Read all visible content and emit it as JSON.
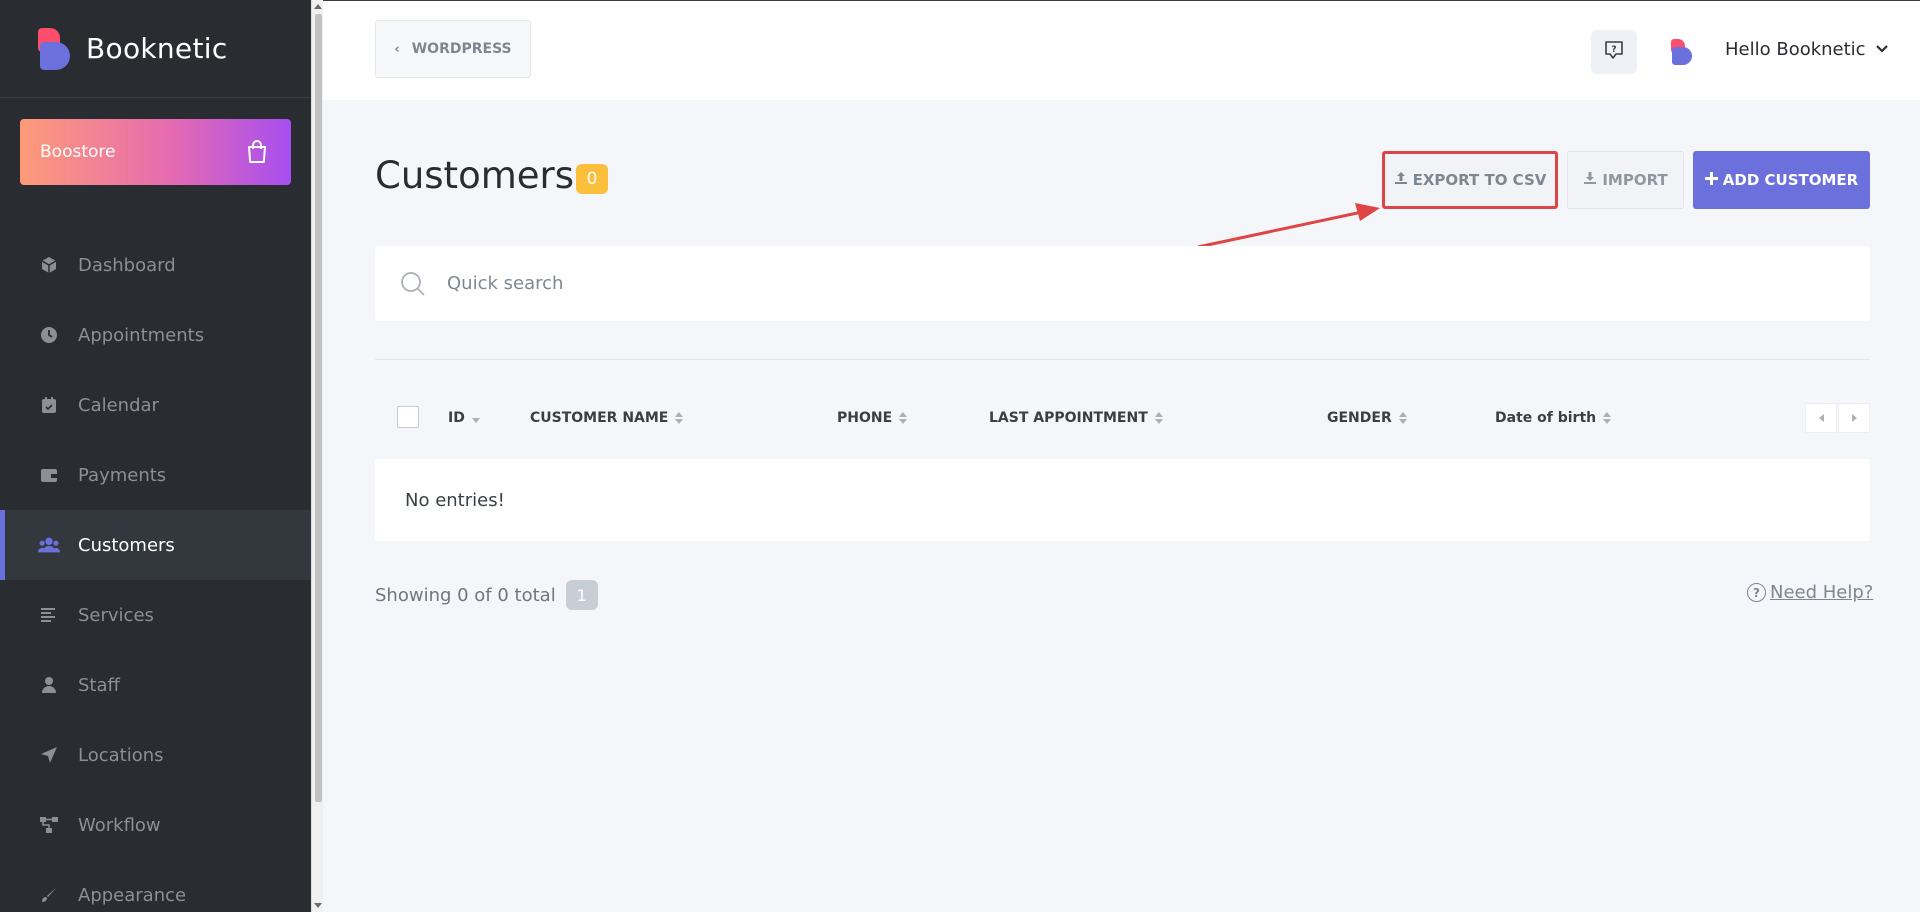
{
  "app": {
    "name": "Booknetic"
  },
  "boostore": {
    "label": "Boostore"
  },
  "sidebar": {
    "items": [
      {
        "label": "Dashboard",
        "icon": "cube-icon",
        "active": false
      },
      {
        "label": "Appointments",
        "icon": "clock-icon",
        "active": false
      },
      {
        "label": "Calendar",
        "icon": "calendar-icon",
        "active": false
      },
      {
        "label": "Payments",
        "icon": "wallet-icon",
        "active": false
      },
      {
        "label": "Customers",
        "icon": "users-icon",
        "active": true
      },
      {
        "label": "Services",
        "icon": "list-icon",
        "active": false
      },
      {
        "label": "Staff",
        "icon": "user-icon",
        "active": false
      },
      {
        "label": "Locations",
        "icon": "location-arrow-icon",
        "active": false
      },
      {
        "label": "Workflow",
        "icon": "workflow-icon",
        "active": false
      },
      {
        "label": "Appearance",
        "icon": "brush-icon",
        "active": false
      }
    ]
  },
  "topbar": {
    "back_label": "WORDPRESS",
    "user_greeting": "Hello Booknetic"
  },
  "page": {
    "title": "Customers",
    "count": "0"
  },
  "actions": {
    "export_label": "EXPORT TO CSV",
    "import_label": "IMPORT",
    "add_label": "ADD CUSTOMER"
  },
  "search": {
    "placeholder": "Quick search",
    "value": ""
  },
  "table": {
    "columns": [
      "ID",
      "CUSTOMER NAME",
      "PHONE",
      "LAST APPOINTMENT",
      "GENDER",
      "Date of birth"
    ],
    "empty_text": "No entries!"
  },
  "footer": {
    "showing_text": "Showing 0 of 0 total",
    "current_page": "1",
    "help_label": "Need Help?"
  },
  "colors": {
    "accent": "#6c70dc",
    "sidebar_bg": "#292d32",
    "badge": "#fbbf3b",
    "highlight": "#e04545"
  }
}
